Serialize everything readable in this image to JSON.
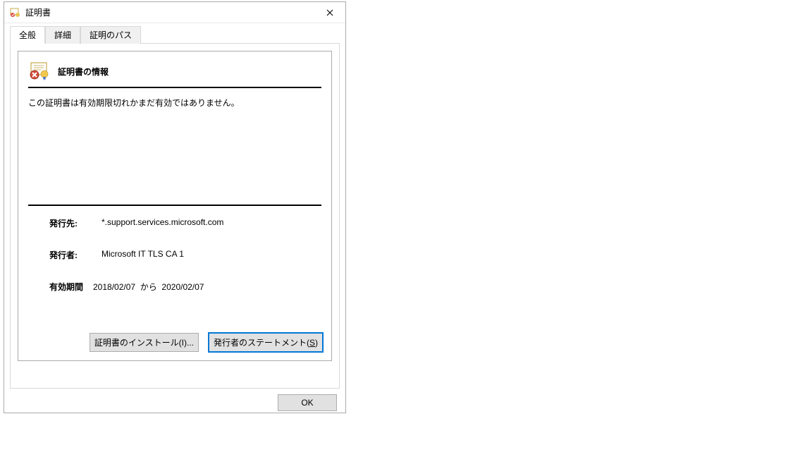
{
  "window": {
    "title": "証明書"
  },
  "tabs": {
    "general": "全般",
    "details": "詳細",
    "path": "証明のパス"
  },
  "cert": {
    "info_title": "証明書の情報",
    "status": "この証明書は有効期限切れかまだ有効ではありません。",
    "issued_to_label": "発行先:",
    "issued_to_value": "*.support.services.microsoft.com",
    "issuer_label": "発行者:",
    "issuer_value": "Microsoft IT TLS CA 1",
    "validity_label": "有効期間",
    "validity_from": "2018/02/07",
    "validity_sep": "から",
    "validity_to": "2020/02/07"
  },
  "buttons": {
    "install": "証明書のインストール(I)...",
    "statement_prefix": "発行者のステートメント(",
    "statement_key": "S",
    "statement_suffix": ")",
    "ok": "OK"
  }
}
